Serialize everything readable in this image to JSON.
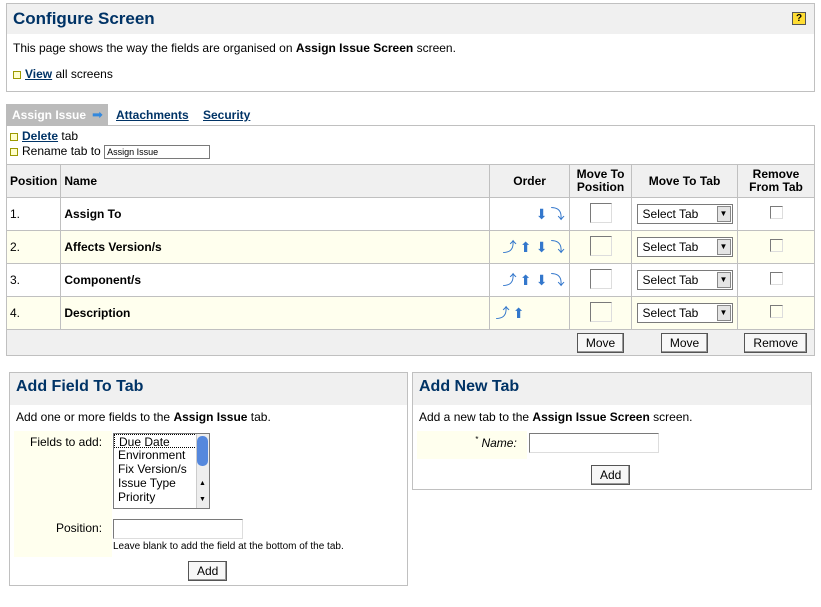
{
  "header": {
    "title": "Configure Screen",
    "help_icon": "?",
    "desc_prefix": "This page shows the way the fields are organised on ",
    "screen_name": "Assign Issue Screen",
    "desc_suffix": " screen.",
    "view_link": "View",
    "view_suffix": " all screens"
  },
  "tabs": {
    "active": "Assign Issue",
    "others": [
      "Attachments",
      "Security"
    ]
  },
  "tab_ops": {
    "delete_link": "Delete",
    "delete_suffix": " tab",
    "rename_label": "Rename tab to",
    "rename_value": "Assign Issue"
  },
  "table": {
    "headers": {
      "position": "Position",
      "name": "Name",
      "order": "Order",
      "move_to_position": "Move To Position",
      "move_to_tab": "Move To Tab",
      "remove": "Remove From Tab"
    },
    "rows": [
      {
        "pos": "1.",
        "name": "Assign To",
        "select": "Select Tab"
      },
      {
        "pos": "2.",
        "name": "Affects Version/s",
        "select": "Select Tab"
      },
      {
        "pos": "3.",
        "name": "Component/s",
        "select": "Select Tab"
      },
      {
        "pos": "4.",
        "name": "Description",
        "select": "Select Tab"
      }
    ],
    "buttons": {
      "move1": "Move",
      "move2": "Move",
      "remove": "Remove"
    }
  },
  "add_field": {
    "title": "Add Field To Tab",
    "desc_prefix": "Add one or more fields to the ",
    "tab_name": "Assign Issue",
    "desc_suffix": " tab.",
    "fields_label": "Fields to add:",
    "options": [
      "Due Date",
      "Environment",
      "Fix Version/s",
      "Issue Type",
      "Priority"
    ],
    "position_label": "Position:",
    "hint": "Leave blank to add the field at the bottom of the tab.",
    "button": "Add"
  },
  "add_tab": {
    "title": "Add New Tab",
    "desc_prefix": "Add a new tab to the ",
    "screen_name": "Assign Issue Screen",
    "desc_suffix": " screen.",
    "required_mark": "*",
    "name_label": "Name",
    "button": "Add"
  }
}
